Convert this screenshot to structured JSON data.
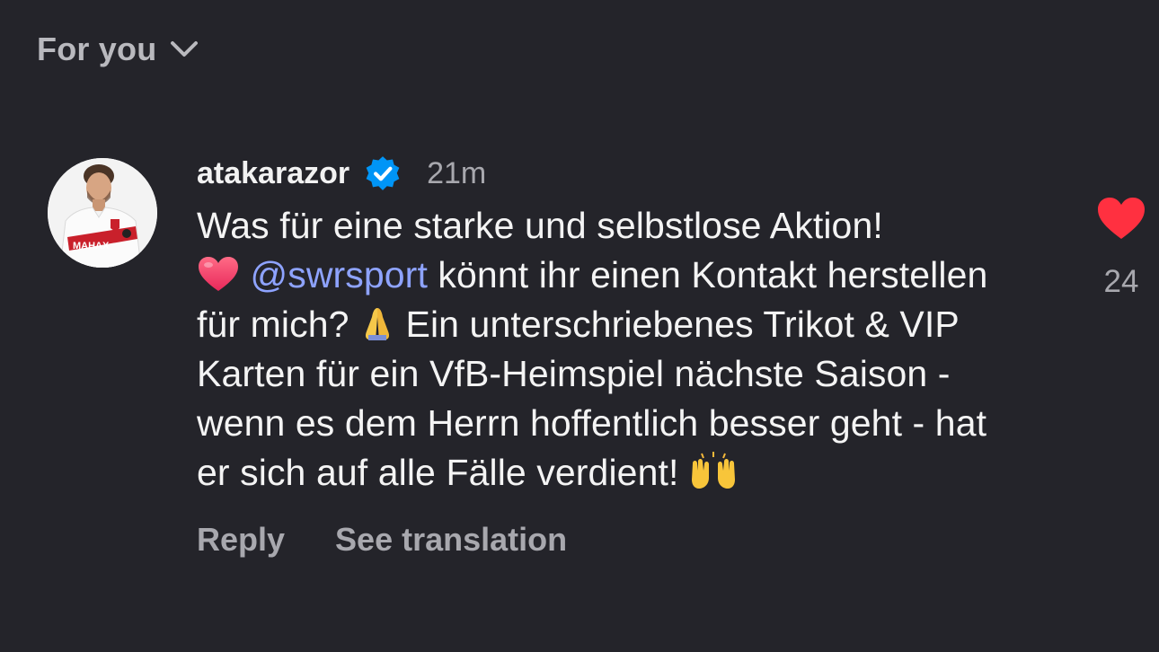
{
  "feed": {
    "selector_label": "For you",
    "chevron_icon": "chevron-down-icon"
  },
  "comment": {
    "username": "atakarazor",
    "verified": true,
    "time": "21m",
    "text_parts": {
      "line_1": "Was für eine starke und selbstlose Aktion!",
      "mention": "@swrsport",
      "after_mention": " könnt ihr einen Kontakt herstellen für mich? ",
      "middle": " Ein unterschriebenes Trikot & VIP Karten für ein VfB-Heimspiel nächste Saison - wenn es dem Herrn hoffentlich besser geht - hat er sich auf alle Fälle verdient! "
    },
    "emojis": [
      "heart-emoji",
      "folded-hands-emoji",
      "raising-hands-emoji"
    ],
    "actions": {
      "reply": "Reply",
      "translate": "See translation"
    },
    "likes": {
      "count": "24",
      "liked": true,
      "icon": "heart-icon"
    },
    "avatar": {
      "shirt_text": "MAHAX"
    }
  },
  "colors": {
    "background": "#24242a",
    "text": "#f4f4f4",
    "muted": "#a8a8ae",
    "mention": "#8ea3ff",
    "like": "#ff3040",
    "verified": "#0095f6"
  }
}
